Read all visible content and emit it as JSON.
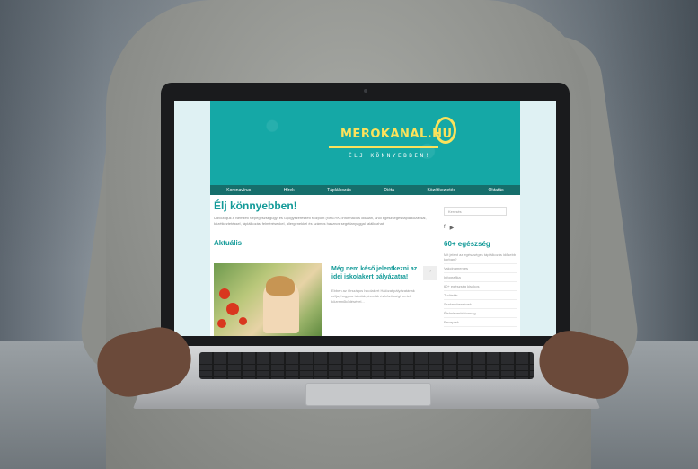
{
  "website": {
    "logo": "MEROKANAL.HU",
    "tagline": "ÉLJ KÖNNYEBBEN!",
    "nav": [
      "Koronavírus",
      "Hírek",
      "Táplálkozás",
      "Diéta",
      "Közétkeztetés",
      "Oktatás"
    ],
    "page_title": "Élj könnyebben!",
    "intro": "Üdvözöljük a Nemzeti Népegészségügyi és Gyógyszerészeti Központ (NNGYK) információs oldalán, ahol egészséges táplálkozással, közétkeztetéssel, táplálkozási felmérésekkel, allergénekkel és számos hasznos segédanyaggal találkozhat.",
    "section": "Aktuális",
    "article": {
      "title": "Még nem késő jelentkezni az idei iskolakert pályázatra!",
      "text": "Ebben az Országos Iskolakert Hálózat pályázatának célja, hogy az iskolák, óvodák és közösségi kertek közreműködésével..."
    },
    "comment": "?",
    "search_placeholder": "Keresés",
    "sidebar_title": "60+ egészség",
    "sidebar_links": [
      "Mit jelent az egészséges táplálkozás idősebb korban?",
      "Vakcinamentes",
      "Infografika",
      "60+ egészség kisokos",
      "Tudástár",
      "Szakembereknek",
      "Élelmiszerbiztonság",
      "Receptek"
    ]
  },
  "colors": {
    "teal": "#15a8a6",
    "nav": "#166e6b",
    "yellow": "#fbe25b"
  }
}
